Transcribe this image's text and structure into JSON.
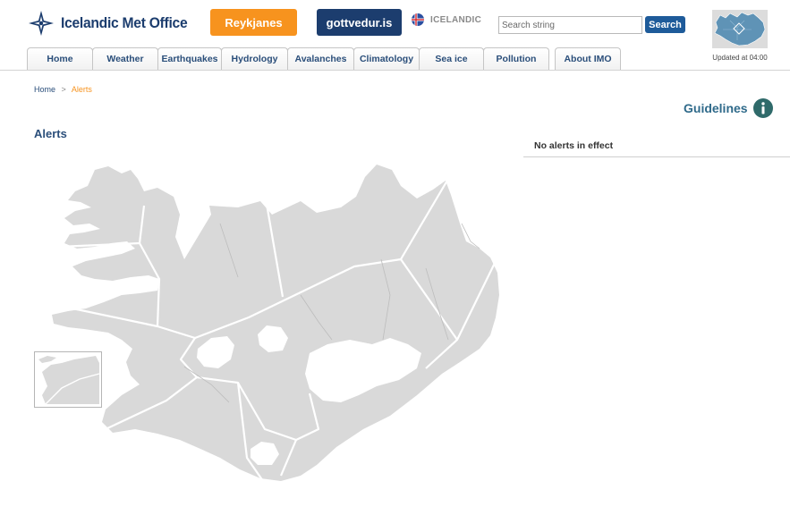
{
  "header": {
    "logo_text": "Icelandic Met Office",
    "reykjanes_label": "Reykjanes",
    "gottvedur_label": "gottvedur.is",
    "language_label": "ICELANDIC",
    "search": {
      "placeholder": "Search string",
      "button_label": "Search"
    },
    "updated_text": "Updated at 04:00"
  },
  "nav": {
    "tabs": [
      {
        "label": "Home"
      },
      {
        "label": "Weather"
      },
      {
        "label": "Earthquakes"
      },
      {
        "label": "Hydrology"
      },
      {
        "label": "Avalanches"
      },
      {
        "label": "Climatology"
      },
      {
        "label": "Sea ice"
      },
      {
        "label": "Pollution"
      },
      {
        "label": "About IMO"
      }
    ]
  },
  "breadcrumb": {
    "home": "Home",
    "separator": ">",
    "current": "Alerts"
  },
  "main": {
    "title": "Alerts",
    "guidelines_label": "Guidelines",
    "alerts_status": "No alerts in effect"
  },
  "colors": {
    "brand_blue": "#1c3d6e",
    "accent_orange": "#f7931e",
    "link_blue": "#2a4e7a",
    "map_fill": "#d9d9d9",
    "region_border": "#ffffff"
  }
}
